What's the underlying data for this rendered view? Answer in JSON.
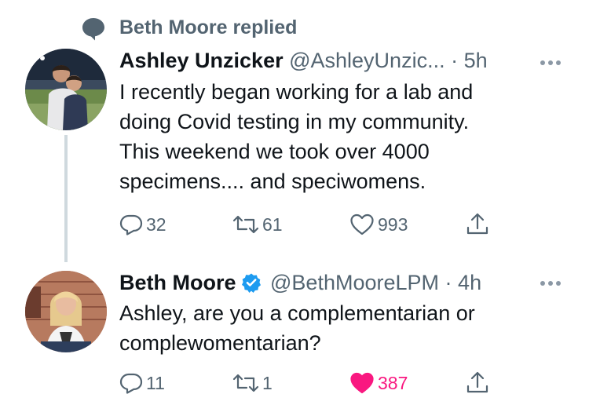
{
  "context": {
    "icon": "speech-bubble-icon",
    "text": "Beth Moore replied"
  },
  "tweets": [
    {
      "name": "Ashley Unzicker",
      "verified": false,
      "handle": "@AshleyUnzic...",
      "separator": "·",
      "time": "5h",
      "text_lines": [
        "I recently began working for a lab and",
        "doing Covid testing in my community.",
        "This weekend we took over 4000",
        "specimens.... and speciwomens."
      ],
      "replies": "32",
      "retweets": "61",
      "likes": "993",
      "liked": false
    },
    {
      "name": "Beth Moore",
      "verified": true,
      "handle": "@BethMooreLPM",
      "separator": "·",
      "time": "4h",
      "text_lines": [
        "Ashley, are you a complementarian or",
        "complewomentarian?"
      ],
      "replies": "11",
      "retweets": "1",
      "likes": "387",
      "liked": true
    }
  ],
  "colors": {
    "secondary": "#536471",
    "like": "#f91880",
    "verified": "#1d9bf0",
    "thread_line": "#cfd9de"
  }
}
